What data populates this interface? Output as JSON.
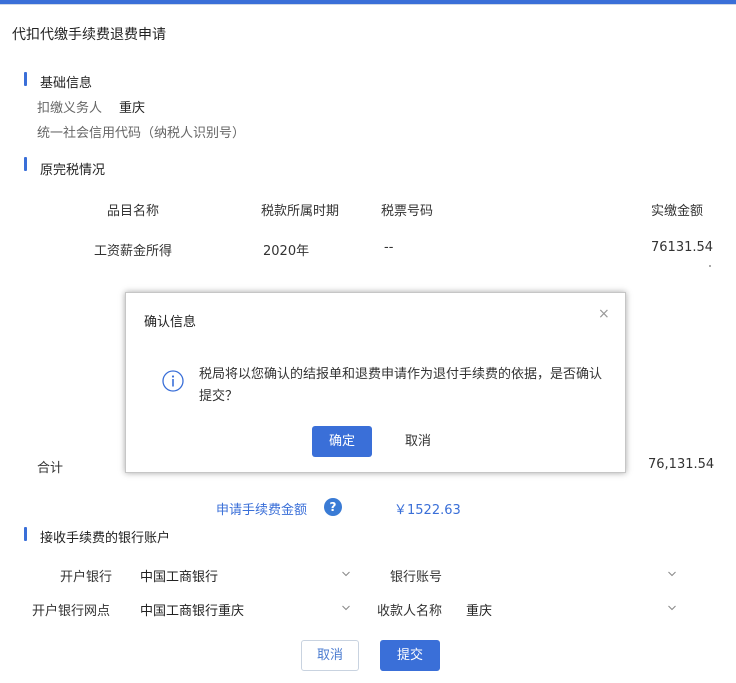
{
  "page": {
    "title": "代扣代缴手续费退费申请"
  },
  "basic_info": {
    "section_title": "基础信息",
    "agent_label": "扣缴义务人",
    "agent_value": "重庆",
    "credit_code_label": "统一社会信用代码（纳税人识别号）"
  },
  "tax_section": {
    "section_title": "原完税情况",
    "headers": [
      "品目名称",
      "税款所属时期",
      "税票号码",
      "实缴金额"
    ],
    "rows": [
      {
        "item": "工资薪金所得",
        "period": "2020年",
        "ticket": "--",
        "amount": "76131.54"
      }
    ],
    "total_label": "合计",
    "total_value": "76,131.54",
    "fee_label": "申请手续费金额",
    "fee_help": "?",
    "fee_amount": "￥1522.63"
  },
  "bank_section": {
    "section_title": "接收手续费的银行账户",
    "bank_label": "开户银行",
    "bank_value": "中国工商银行",
    "account_label": "银行账号",
    "account_value": "",
    "branch_label": "开户银行网点",
    "branch_value": "中国工商银行重庆",
    "payee_label": "收款人名称",
    "payee_value": "重庆"
  },
  "actions": {
    "cancel_label": "取消",
    "submit_label": "提交"
  },
  "modal": {
    "title": "确认信息",
    "close_symbol": "×",
    "message": "税局将以您确认的结报单和退费申请作为退付手续费的依据，是否确认提交？",
    "ok_label": "确定",
    "cancel_label": "取消"
  },
  "colors": {
    "accent": "#3a6fd8",
    "text": "#333333",
    "muted": "#666666"
  }
}
